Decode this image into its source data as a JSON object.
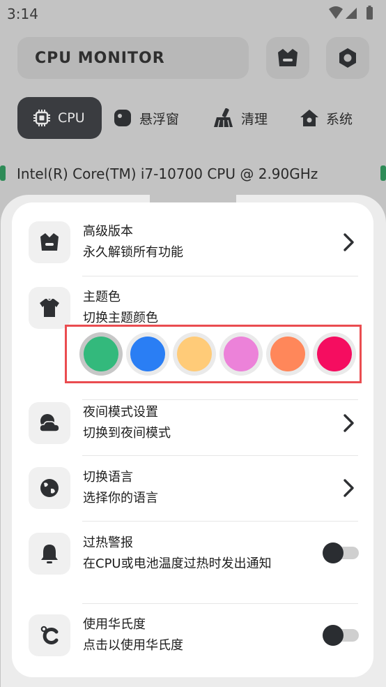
{
  "status": {
    "time": "3:14"
  },
  "header": {
    "app_title": "CPU MONITOR",
    "crown_icon": "crown-icon",
    "settings_icon": "gear-icon"
  },
  "tabs": [
    {
      "label": "CPU",
      "icon": "cpu-chip-icon",
      "active": true
    },
    {
      "label": "悬浮窗",
      "icon": "floating-window-icon",
      "active": false
    },
    {
      "label": "清理",
      "icon": "broom-icon",
      "active": false
    },
    {
      "label": "系统",
      "icon": "home-icon",
      "active": false
    }
  ],
  "cpu": {
    "name": "Intel(R) Core(TM) i7-10700 CPU @ 2.90GHz"
  },
  "settings": {
    "premium": {
      "title": "高级版本",
      "subtitle": "永久解锁所有功能"
    },
    "theme": {
      "title": "主题色",
      "subtitle": "切换主题颜色",
      "colors": [
        "#33b97c",
        "#2a7ef4",
        "#ffcb78",
        "#ec82d9",
        "#ff875a",
        "#f50d60"
      ],
      "selected_index": 0
    },
    "night": {
      "title": "夜间模式设置",
      "subtitle": "切换到夜间模式"
    },
    "language": {
      "title": "切换语言",
      "subtitle": "选择你的语言"
    },
    "overheat": {
      "title": "过热警报",
      "subtitle": "在CPU或电池温度过热时发出通知",
      "enabled": false
    },
    "fahrenheit": {
      "title": "使用华氏度",
      "subtitle": "点击以使用华氏度",
      "enabled": false
    }
  }
}
